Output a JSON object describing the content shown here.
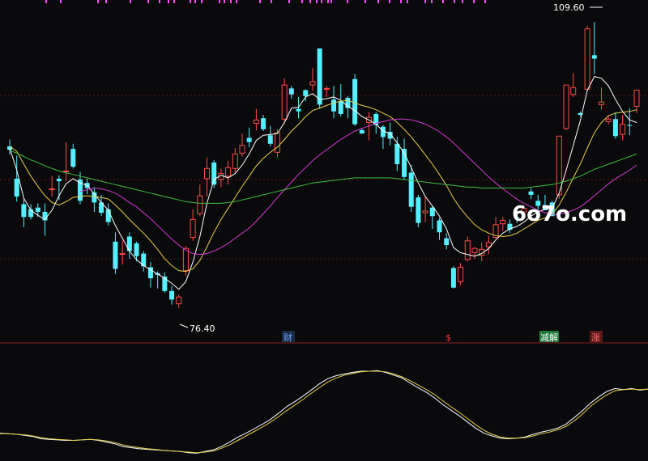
{
  "watermark": "6o7o.com",
  "annotations": {
    "high_label": "109.60",
    "low_label": "76.40"
  },
  "events": [
    {
      "label": "财",
      "color": "#6fa8ff",
      "bg": "#1a2a44"
    },
    {
      "label": "$",
      "color": "#ff3b3b",
      "bg": "#0a0a0c"
    },
    {
      "label": "减解",
      "color": "#ffffff",
      "bg": "#1f7a3a"
    },
    {
      "label": "涨",
      "color": "#ff6b6b",
      "bg": "#5a1a1a"
    }
  ],
  "colors": {
    "background": "#0a0a0c",
    "up": "#ff4a4a",
    "down": "#54f0ff",
    "ma_short": "#ffffff",
    "ma_mid": "#e6d04a",
    "ma_long": "#d23bd2",
    "ma_longest": "#3fbf3f",
    "grid": "#5a1a1a",
    "top_ticks": "#ff44ff",
    "osc_fast": "#ffffff",
    "osc_slow": "#e6d04a"
  },
  "chart_data": [
    {
      "type": "candlestick",
      "title": "",
      "xlabel": "",
      "ylabel": "",
      "ylim": [
        72,
        112
      ],
      "grid": true,
      "high_point": 109.6,
      "low_point": 76.4,
      "candles": [
        [
          95,
          95.8,
          94,
          94.6
        ],
        [
          91.2,
          93.9,
          88.5,
          89.1
        ],
        [
          88.2,
          88.8,
          85.5,
          86.7
        ],
        [
          87.6,
          88.2,
          86.4,
          86.7
        ],
        [
          87.8,
          88.3,
          86.7,
          87.3
        ],
        [
          87.3,
          88.3,
          84.5,
          86.3
        ],
        [
          90,
          91.5,
          89.1,
          90
        ],
        [
          91.2,
          91.6,
          88.7,
          90.9
        ],
        [
          92.1,
          95.5,
          90.9,
          92.1
        ],
        [
          94.7,
          95.3,
          92.4,
          92.6
        ],
        [
          91.1,
          92,
          88.2,
          88.6
        ],
        [
          90.7,
          91.2,
          89.4,
          90.1
        ],
        [
          89.6,
          90.2,
          87.3,
          88.4
        ],
        [
          88.4,
          89.3,
          86.8,
          87.2
        ],
        [
          87.6,
          88.3,
          85.7,
          86.1
        ],
        [
          83.8,
          84.9,
          80,
          80.6
        ],
        [
          82.4,
          83.9,
          81.1,
          82.4
        ],
        [
          84.4,
          84.9,
          81.8,
          82.7
        ],
        [
          83.6,
          83.8,
          81.5,
          82.1
        ],
        [
          82.4,
          82.7,
          80.3,
          80.9
        ],
        [
          80.8,
          81.4,
          78.4,
          79.5
        ],
        [
          80.1,
          80.3,
          78.3,
          79.9
        ],
        [
          79.7,
          80.2,
          77.8,
          78
        ],
        [
          78,
          78.6,
          76.4,
          77
        ],
        [
          76.5,
          77.6,
          76,
          77.3
        ],
        [
          80.4,
          83.3,
          79.8,
          83
        ],
        [
          84.3,
          87.6,
          83.9,
          86.4
        ],
        [
          87.1,
          90.5,
          86.8,
          89.2
        ],
        [
          91.2,
          93.7,
          89.1,
          92.4
        ],
        [
          93.1,
          93.4,
          90.1,
          90.5
        ],
        [
          91.1,
          92.4,
          90.2,
          91.8
        ],
        [
          91.5,
          93.3,
          90.5,
          92.5
        ],
        [
          92.4,
          94.8,
          91.9,
          94.1
        ],
        [
          94.2,
          96.5,
          93.8,
          95.1
        ],
        [
          96,
          97.2,
          94.9,
          95.5
        ],
        [
          97.7,
          99.4,
          96.9,
          98.1
        ],
        [
          98.3,
          98.7,
          96.8,
          97
        ],
        [
          96.3,
          97.4,
          95,
          95.3
        ],
        [
          94.3,
          97,
          93.7,
          96.6
        ],
        [
          98.2,
          103,
          97.6,
          102.2
        ],
        [
          101.8,
          102.1,
          100.6,
          101.1
        ],
        [
          99.4,
          100.8,
          98.3,
          99.1
        ],
        [
          101.6,
          101.7,
          100.3,
          100.9
        ],
        [
          102.2,
          104.2,
          101.5,
          102.6
        ],
        [
          106.5,
          106.5,
          99.4,
          99.9
        ],
        [
          101.8,
          102.1,
          100.8,
          101.8
        ],
        [
          100.5,
          102.1,
          98.3,
          99.1
        ],
        [
          100.3,
          102.3,
          98.5,
          98.8
        ],
        [
          100.7,
          100.9,
          98.3,
          99.5
        ],
        [
          102.9,
          103.5,
          97.4,
          97.6
        ],
        [
          96.9,
          97.1,
          96.5,
          96.5
        ],
        [
          97.8,
          99,
          95.7,
          98.4
        ],
        [
          98.8,
          99,
          96.5,
          97.5
        ],
        [
          97.3,
          97.5,
          94.7,
          96.1
        ],
        [
          96.7,
          97.8,
          95.1,
          95.9
        ],
        [
          95.3,
          96.1,
          92.1,
          92.9
        ],
        [
          94.7,
          95.9,
          91.1,
          91.4
        ],
        [
          91.9,
          92.8,
          87.3,
          87.9
        ],
        [
          89,
          89.3,
          85.5,
          86
        ],
        [
          87.2,
          89.1,
          86.1,
          87.4
        ],
        [
          87.8,
          87.9,
          85.3,
          86.8
        ],
        [
          86.3,
          86.6,
          84,
          84.9
        ],
        [
          84.2,
          84.8,
          82.9,
          83.4
        ],
        [
          80.7,
          80.9,
          78.3,
          78.4
        ],
        [
          79.1,
          81.3,
          78.7,
          80.8
        ],
        [
          81.7,
          84.4,
          81.5,
          83.9
        ],
        [
          82.5,
          83.2,
          81.8,
          83
        ],
        [
          82.2,
          83.7,
          81.5,
          82.9
        ],
        [
          83.2,
          84.5,
          82.3,
          83.7
        ],
        [
          84.3,
          86.7,
          84.1,
          85.8
        ],
        [
          85.9,
          86.7,
          85.1,
          86.3
        ],
        [
          85.9,
          86.4,
          84.8,
          85.2
        ],
        [
          86.7,
          87,
          86,
          86.6
        ],
        [
          87.3,
          88,
          86.8,
          87.7
        ],
        [
          89.7,
          90.1,
          88.8,
          89.3
        ],
        [
          88.6,
          89.3,
          87.4,
          88
        ],
        [
          88.1,
          89.3,
          87.5,
          87.5
        ],
        [
          88.4,
          88.6,
          86.8,
          86.8
        ],
        [
          89.3,
          96.2,
          88.8,
          96.2
        ],
        [
          97.1,
          102.2,
          96.9,
          102.2
        ],
        [
          101.1,
          103.6,
          100.8,
          101.9
        ],
        [
          98.9,
          99.1,
          98.5,
          98.7
        ],
        [
          101.7,
          109.2,
          101.4,
          108.8
        ],
        [
          105.7,
          109.6,
          103.5,
          105.3
        ],
        [
          99.9,
          101.9,
          99.3,
          100.2
        ],
        [
          97.9,
          98.6,
          97.6,
          98.2
        ],
        [
          98.2,
          99,
          95.9,
          96.2
        ],
        [
          96.4,
          98.7,
          95.7,
          97.6
        ],
        [
          97.5,
          99.5,
          96.3,
          97.4
        ],
        [
          99.7,
          101.6,
          98.9,
          101.6
        ]
      ],
      "series": [
        {
          "values": [
            94.8,
            92.2,
            88.9,
            87.5,
            86.9,
            86.4,
            87.5,
            89.2,
            90.6,
            91.2,
            90.7,
            90.4,
            89.4,
            88.4,
            87.5,
            85.7,
            84.2,
            82.7,
            81.7,
            81,
            80.5,
            80,
            79.5,
            78.9,
            78.2,
            79.1,
            81.4,
            84.4,
            88.3,
            91.1,
            91.6,
            91.3,
            91.8,
            92.8,
            94.1,
            95.7,
            96.3,
            96.4,
            96.5,
            97.8,
            99.5,
            99.6,
            100.8,
            101.2,
            100.5,
            100.6,
            100.8,
            100.4,
            99.7,
            99.2,
            98.5,
            98.1,
            97.6,
            96.8,
            96.5,
            95.4,
            94.2,
            92.5,
            90.7,
            89.1,
            88,
            86.8,
            85.3,
            83.1,
            82.5,
            82.3,
            82.1,
            82.4,
            83,
            84,
            84.8,
            85.3,
            85.6,
            86.1,
            86.8,
            87.3,
            87.6,
            87.7,
            89.5,
            92.2,
            95.1,
            98,
            101.6,
            103.2,
            103,
            102.1,
            100.5,
            99.1,
            98.1,
            97.8
          ]
        },
        {
          "values": [
            95,
            94.4,
            92.9,
            91.5,
            90.3,
            89.2,
            88.4,
            88.1,
            88.5,
            89,
            89.1,
            89.2,
            89.1,
            89,
            88.8,
            88.1,
            87.3,
            86.4,
            85.6,
            84.8,
            83.9,
            82.9,
            81.8,
            81,
            80.4,
            80.3,
            80.6,
            81.6,
            83.2,
            84.9,
            86.4,
            87.7,
            89,
            90.3,
            91.5,
            92.7,
            93.6,
            94.3,
            94.9,
            95.8,
            96.8,
            97.6,
            98.5,
            99.2,
            99.5,
            99.8,
            100.1,
            100.3,
            100.4,
            100.1,
            99.8,
            99.6,
            99.3,
            98.9,
            98.5,
            97.8,
            97,
            96.1,
            95.1,
            94,
            92.9,
            91.7,
            90.4,
            88.9,
            87.7,
            86.7,
            85.8,
            85.2,
            84.8,
            84.5,
            84.4,
            84.5,
            84.8,
            85.3,
            85.8,
            86.3,
            86.6,
            87,
            88.1,
            89.6,
            91.3,
            92.9,
            94.8,
            96.6,
            97.8,
            98.6,
            98.9,
            99,
            99.1,
            99.3
          ]
        },
        {
          "values": [
            null,
            null,
            null,
            null,
            null,
            null,
            null,
            null,
            null,
            null,
            89.7,
            89.9,
            90.1,
            90,
            89.8,
            89.5,
            89,
            88.4,
            87.9,
            87.2,
            86.5,
            85.7,
            84.9,
            84.1,
            83.4,
            82.8,
            82.4,
            82.3,
            82.4,
            82.7,
            83.1,
            83.6,
            84.2,
            84.8,
            85.4,
            86.2,
            87.1,
            88,
            89,
            89.9,
            90.8,
            91.7,
            92.5,
            93.3,
            94,
            94.6,
            95.2,
            95.8,
            96.3,
            96.8,
            97.1,
            97.4,
            97.7,
            97.9,
            98.1,
            98.2,
            98.2,
            98.1,
            97.9,
            97.6,
            97.2,
            96.7,
            96.1,
            95.4,
            94.6,
            93.8,
            93,
            92.2,
            91.4,
            90.7,
            90,
            89.4,
            88.8,
            88.3,
            87.9,
            87.5,
            87.2,
            87,
            87,
            87.2,
            87.5,
            87.9,
            88.5,
            89.2,
            89.9,
            90.6,
            91.2,
            91.7,
            92.2,
            92.8
          ]
        },
        {
          "values": [
            94.5,
            94.2,
            93.8,
            93.4,
            93.1,
            92.7,
            92.4,
            92.1,
            91.9,
            91.7,
            91.5,
            91.3,
            91.1,
            90.9,
            90.7,
            90.5,
            90.3,
            90.1,
            89.9,
            89.7,
            89.5,
            89.3,
            89.1,
            88.9,
            88.7,
            88.5,
            88.4,
            88.3,
            88.3,
            88.3,
            88.3,
            88.4,
            88.5,
            88.7,
            88.9,
            89.1,
            89.3,
            89.5,
            89.7,
            89.9,
            90.1,
            90.3,
            90.5,
            90.7,
            90.8,
            90.9,
            91,
            91.1,
            91.2,
            91.3,
            91.3,
            91.3,
            91.3,
            91.3,
            91.3,
            91.2,
            91.1,
            91,
            90.9,
            90.8,
            90.7,
            90.6,
            90.5,
            90.4,
            90.3,
            90.2,
            90.2,
            90.1,
            90.1,
            90.1,
            90.1,
            90.1,
            90.1,
            90.1,
            90.2,
            90.3,
            90.4,
            90.5,
            90.7,
            90.9,
            91.2,
            91.5,
            91.9,
            92.3,
            92.6,
            92.9,
            93.2,
            93.5,
            93.8,
            94.1
          ]
        }
      ]
    },
    {
      "type": "line",
      "title": "",
      "xlabel": "",
      "ylabel": "",
      "ylim": [
        -1,
        1
      ],
      "grid": false,
      "series": [
        {
          "values": [
            -0.53,
            -0.54,
            -0.55,
            -0.57,
            -0.59,
            -0.63,
            -0.64,
            -0.65,
            -0.66,
            -0.66,
            -0.65,
            -0.64,
            -0.66,
            -0.69,
            -0.72,
            -0.77,
            -0.79,
            -0.81,
            -0.82,
            -0.83,
            -0.84,
            -0.85,
            -0.86,
            -0.88,
            -0.89,
            -0.86,
            -0.83,
            -0.77,
            -0.69,
            -0.6,
            -0.53,
            -0.45,
            -0.37,
            -0.28,
            -0.17,
            -0.05,
            0.04,
            0.14,
            0.25,
            0.36,
            0.45,
            0.5,
            0.53,
            0.56,
            0.58,
            0.58,
            0.59,
            0.56,
            0.51,
            0.46,
            0.37,
            0.28,
            0.2,
            0.1,
            -0.02,
            -0.12,
            -0.22,
            -0.33,
            -0.44,
            -0.53,
            -0.58,
            -0.62,
            -0.63,
            -0.62,
            -0.6,
            -0.55,
            -0.51,
            -0.48,
            -0.44,
            -0.37,
            -0.25,
            -0.13,
            0.01,
            0.12,
            0.22,
            0.27,
            0.25,
            0.27,
            0.24,
            0.26
          ]
        },
        {
          "values": [
            -0.54,
            -0.54,
            -0.55,
            -0.56,
            -0.58,
            -0.61,
            -0.63,
            -0.64,
            -0.65,
            -0.66,
            -0.65,
            -0.64,
            -0.65,
            -0.67,
            -0.7,
            -0.74,
            -0.77,
            -0.79,
            -0.81,
            -0.82,
            -0.84,
            -0.85,
            -0.86,
            -0.87,
            -0.88,
            -0.87,
            -0.85,
            -0.8,
            -0.74,
            -0.66,
            -0.58,
            -0.5,
            -0.42,
            -0.33,
            -0.23,
            -0.12,
            -0.02,
            0.08,
            0.19,
            0.29,
            0.39,
            0.46,
            0.51,
            0.54,
            0.57,
            0.58,
            0.58,
            0.57,
            0.53,
            0.48,
            0.41,
            0.33,
            0.25,
            0.16,
            0.05,
            -0.06,
            -0.16,
            -0.27,
            -0.38,
            -0.48,
            -0.55,
            -0.6,
            -0.62,
            -0.62,
            -0.61,
            -0.58,
            -0.54,
            -0.51,
            -0.47,
            -0.41,
            -0.31,
            -0.19,
            -0.05,
            0.06,
            0.16,
            0.23,
            0.25,
            0.26,
            0.25,
            0.26
          ]
        }
      ]
    }
  ]
}
